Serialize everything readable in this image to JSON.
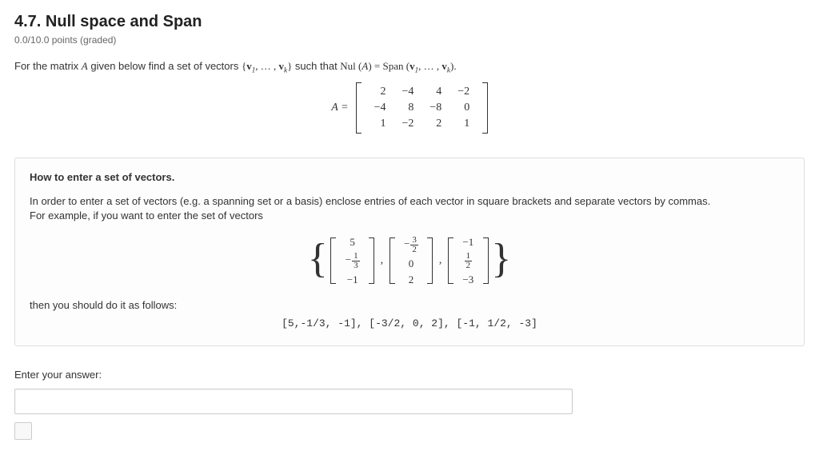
{
  "title": "4.7. Null space and Span",
  "points": "0.0/10.0 points (graded)",
  "prompt_prefix": "For the matrix ",
  "prompt_mid": " given below find a set of vectors ",
  "prompt_suffix": " such that ",
  "matrix": {
    "label": "A =",
    "rows": [
      [
        "2",
        "−4",
        "4",
        "−2"
      ],
      [
        "−4",
        "8",
        "−8",
        "0"
      ],
      [
        "1",
        "−2",
        "2",
        "1"
      ]
    ]
  },
  "info": {
    "title": "How to enter a set of vectors.",
    "line1": "In order to enter a set of vectors (e.g. a spanning set or a basis) enclose entries of each vector in square brackets and separate vectors by commas.",
    "line2": "For example, if you want to enter the set of vectors",
    "then": "then you should do it as follows:",
    "code": "[5,-1/3, -1], [-3/2, 0, 2], [-1, 1/2, -3]"
  },
  "example_vectors": [
    [
      "5",
      "-1/3",
      "-1"
    ],
    [
      "-3/2",
      "0",
      "2"
    ],
    [
      "-1",
      "1/2",
      "-3"
    ]
  ],
  "answer_label": "Enter your answer:",
  "answer_value": "",
  "chart_data": {
    "type": "table",
    "title": "Matrix A",
    "rows": [
      [
        2,
        -4,
        4,
        -2
      ],
      [
        -4,
        8,
        -8,
        0
      ],
      [
        1,
        -2,
        2,
        1
      ]
    ]
  }
}
